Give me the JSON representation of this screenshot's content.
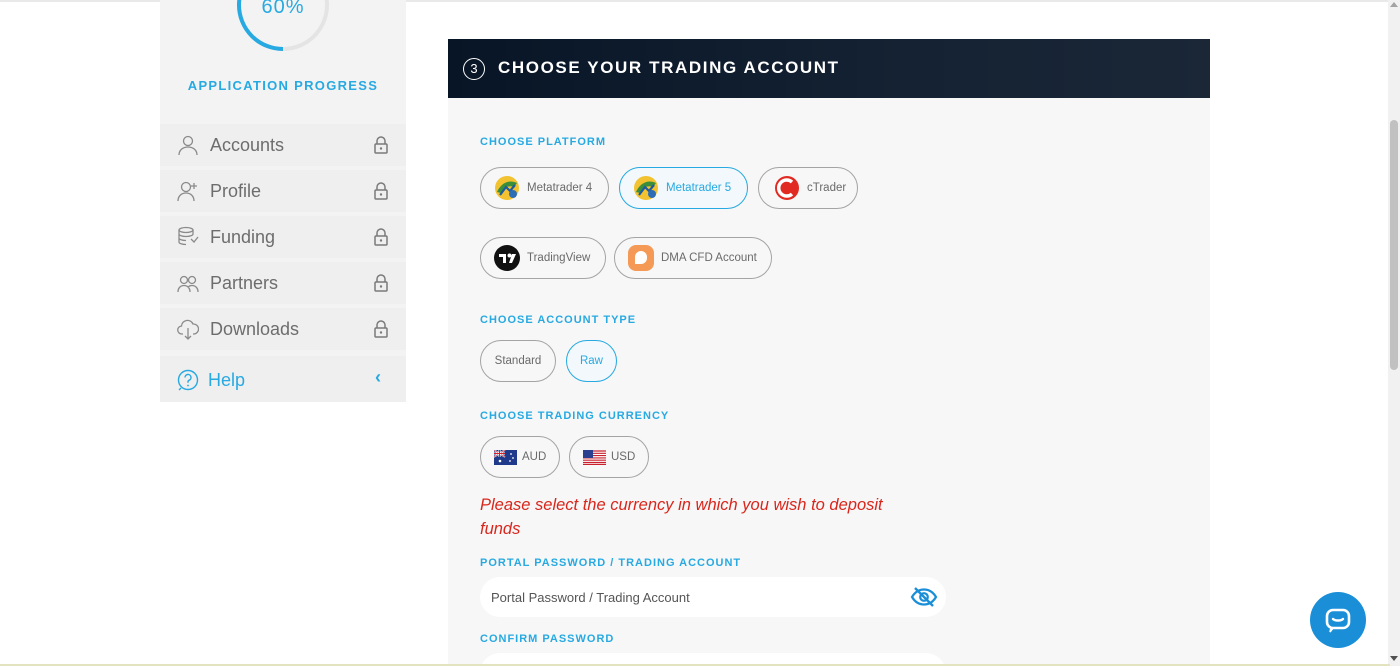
{
  "sidebar": {
    "progress": {
      "value_text": "60%",
      "value": 0.6,
      "label": "APPLICATION PROGRESS"
    },
    "items": [
      {
        "label": "Accounts",
        "icon": "user-icon",
        "locked": true
      },
      {
        "label": "Profile",
        "icon": "user-add-icon",
        "locked": true
      },
      {
        "label": "Funding",
        "icon": "coins-icon",
        "locked": true
      },
      {
        "label": "Partners",
        "icon": "users-icon",
        "locked": true
      },
      {
        "label": "Downloads",
        "icon": "cloud-download-icon",
        "locked": true
      },
      {
        "label": "Help",
        "icon": "help-icon",
        "locked": false
      }
    ]
  },
  "card": {
    "step": "3",
    "title": "CHOOSE YOUR TRADING ACCOUNT",
    "platform": {
      "label": "CHOOSE PLATFORM",
      "options": [
        {
          "label": "Metatrader 4",
          "icon": "metatrader-icon",
          "selected": false
        },
        {
          "label": "Metatrader 5",
          "icon": "metatrader-icon",
          "selected": true
        },
        {
          "label": "cTrader",
          "icon": "ctrader-icon",
          "selected": false
        },
        {
          "label": "TradingView",
          "icon": "tradingview-icon",
          "selected": false
        },
        {
          "label": "DMA CFD Account",
          "icon": "dma-cfd-icon",
          "selected": false
        }
      ]
    },
    "account_type": {
      "label": "CHOOSE ACCOUNT TYPE",
      "options": [
        {
          "label": "Standard",
          "selected": false
        },
        {
          "label": "Raw",
          "selected": true
        }
      ]
    },
    "currency": {
      "label": "CHOOSE TRADING CURRENCY",
      "options": [
        {
          "label": "AUD",
          "icon": "australia-flag-icon",
          "selected": false
        },
        {
          "label": "USD",
          "icon": "usa-flag-icon",
          "selected": false
        }
      ],
      "error": "Please select the currency in which you wish to deposit funds"
    },
    "password": {
      "label": "PORTAL PASSWORD / TRADING ACCOUNT",
      "placeholder": "Portal Password / Trading Account",
      "value": "",
      "toggle_icon": "eye-slash-icon"
    },
    "confirm_password": {
      "label": "CONFIRM PASSWORD"
    }
  },
  "colors": {
    "accent": "#27a9e1",
    "header_bg": "#0b1828",
    "error": "#d9261c",
    "chat_button": "#1a8fd8"
  }
}
